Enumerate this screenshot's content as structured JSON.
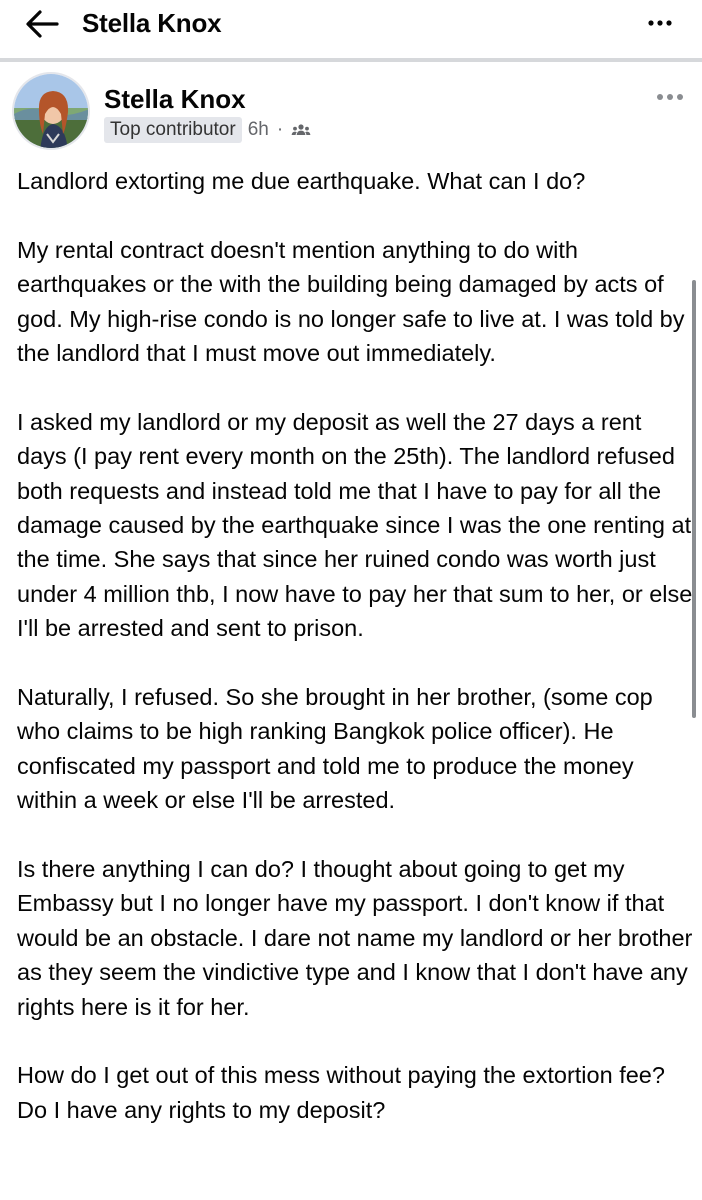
{
  "header": {
    "title": "Stella Knox",
    "back_icon": "arrow-left-icon",
    "more_icon": "more-horizontal-icon"
  },
  "post": {
    "author": "Stella Knox",
    "badge": "Top contributor",
    "time": "6h",
    "separator": "·",
    "audience_icon": "group-audience-icon",
    "more_icon": "more-horizontal-icon",
    "paragraphs": [
      "Landlord extorting me due earthquake. What can I do?",
      "My rental contract doesn't mention anything to do with earthquakes or the with the building being damaged by acts of god. My high-rise condo is no longer safe to live at. I was told by the landlord that I must move out immediately.",
      "I asked my landlord or my deposit as well the 27 days a rent days (I pay rent every month on the 25th). The landlord refused both requests and instead told me that I have to pay for all the damage caused by the earthquake since I was the one renting at the time. She says that since her ruined condo was worth just under 4 million thb, I now have to pay her that sum to her, or else I'll be arrested and sent to prison.",
      "Naturally, I refused. So she brought in her brother, (some cop who claims to be high ranking Bangkok police officer). He confiscated my passport and told me to produce the money within a week or else I'll be arrested.",
      "Is there anything I can do? I thought about going to get my Embassy but I no longer have my passport. I don't know if that would be an obstacle. I dare not name my landlord or her brother as they seem the vindictive type and I know that I don't have any rights here is it for her.",
      "How do I get out of this mess without paying the extortion fee? Do I have any rights to my deposit?"
    ]
  }
}
